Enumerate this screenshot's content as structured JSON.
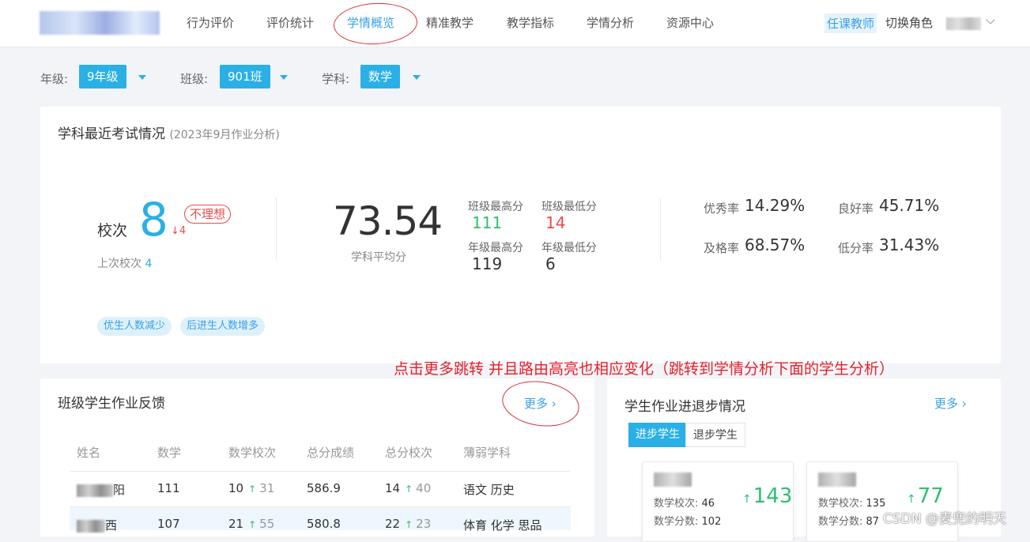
{
  "nav": {
    "items": [
      "行为评价",
      "评价统计",
      "学情概览",
      "精准教学",
      "教学指标",
      "学情分析",
      "资源中心"
    ],
    "active_index": 2,
    "role_tag": "任课教师",
    "switch_role": "切换角色"
  },
  "filters": {
    "grade_label": "年级:",
    "grade_value": "9年级",
    "class_label": "班级:",
    "class_value": "901班",
    "subject_label": "学科:",
    "subject_value": "数学"
  },
  "exam": {
    "title": "学科最近考试情况",
    "subtitle": "(2023年9月作业分析)",
    "rank_label": "校次",
    "rank_value": "8",
    "rank_change": "↓4",
    "rank_badge": "不理想",
    "last_rank_label": "上次校次",
    "last_rank_value": "4",
    "avg_score": "73.54",
    "avg_label": "学科平均分",
    "class_max_label": "班级最高分",
    "class_max_value": "111",
    "class_min_label": "班级最低分",
    "class_min_value": "14",
    "grade_max_label": "年级最高分",
    "grade_max_value": "119",
    "grade_min_label": "年级最低分",
    "grade_min_value": "6",
    "excellent_label": "优秀率",
    "excellent_value": "14.29%",
    "good_label": "良好率",
    "good_value": "45.71%",
    "pass_label": "及格率",
    "pass_value": "68.57%",
    "low_label": "低分率",
    "low_value": "31.43%",
    "tags": [
      "优生人数减少",
      "后进生人数增多"
    ]
  },
  "annotation": "点击更多跳转 并且路由高亮也相应变化（跳转到学情分析下面的学生分析）",
  "homework": {
    "title": "班级学生作业反馈",
    "more": "更多",
    "columns": [
      "姓名",
      "数学",
      "数学校次",
      "总分成绩",
      "总分校次",
      "薄弱学科"
    ],
    "rows": [
      {
        "name": "阳",
        "math": "111",
        "math_rank": "10",
        "math_rank_up": "31",
        "total": "586.9",
        "total_rank": "14",
        "total_rank_up": "40",
        "weak": "语文 历史"
      },
      {
        "name": "西",
        "math": "107",
        "math_rank": "21",
        "math_rank_up": "55",
        "total": "580.8",
        "total_rank": "22",
        "total_rank_up": "23",
        "weak": "体育 化学 思品"
      }
    ]
  },
  "progress": {
    "title": "学生作业进退步情况",
    "more": "更多",
    "tab_up": "进步学生",
    "tab_down": "退步学生",
    "students": [
      {
        "rank_label": "数学校次:",
        "rank_value": "46",
        "score_label": "数学分数:",
        "score_value": "102",
        "change": "143"
      },
      {
        "rank_label": "数学校次:",
        "rank_value": "135",
        "score_label": "数学分数:",
        "score_value": "87",
        "change": "77"
      }
    ]
  },
  "watermark": "CSDN @麦兜的明天",
  "colors": {
    "accent": "#2ab0e6",
    "up": "#2fbf71",
    "down": "#e84b4b",
    "annotation": "#e8202a"
  }
}
